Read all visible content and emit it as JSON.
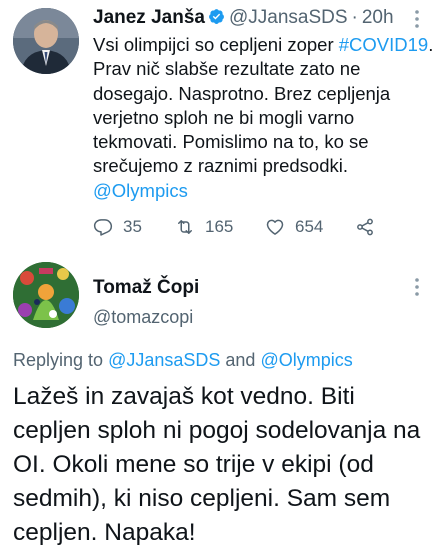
{
  "tweet1": {
    "author_name": "Janez Janša",
    "handle": "@JJansaSDS",
    "separator": "·",
    "time": "20h",
    "text_line1": "Vsi olimpijci so cepljeni zoper ",
    "hashtag": "#COVID19",
    "text_line2": ". Prav nič slabše rezultate zato ne dosegajo. Nasprotno. Brez cepljenja verjetno sploh ne bi mogli varno tekmovati. Pomislimo na to, ko se srečujemo z raznimi predsodki.",
    "mention": "@Olympics",
    "reply_count": "35",
    "retweet_count": "165",
    "like_count": "654",
    "colors": {
      "accent": "#1d9bf0",
      "secondary_text": "#536471",
      "primary_text": "#0f1419"
    }
  },
  "tweet2": {
    "author_name": "Tomaž Čopi",
    "handle": "@tomazcopi",
    "replying_prefix": "Replying to ",
    "replying_mention1": "@JJansaSDS",
    "replying_and": " and ",
    "replying_mention2": "@Olympics",
    "text": "Lažeš in zavajaš kot vedno. Biti cepljen sploh ni pogoj sodelovanja na OI. Okoli mene so trije v ekipi (od sedmih), ki niso cepljeni. Sam sem cepljen. Napaka!"
  },
  "icons": {
    "verified": "verified-badge-icon",
    "more": "more-vertical-icon",
    "reply": "reply-icon",
    "retweet": "retweet-icon",
    "like": "heart-icon",
    "share": "share-icon"
  }
}
